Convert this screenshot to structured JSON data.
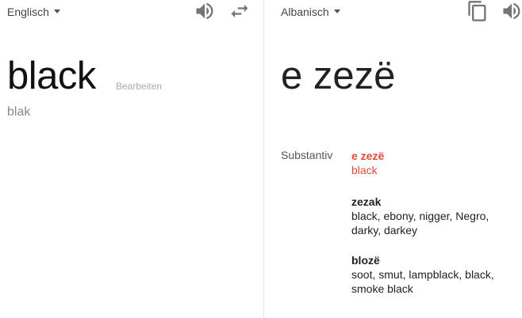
{
  "source": {
    "language": "Englisch",
    "text": "black",
    "edit_label": "Bearbeiten",
    "transliteration": "blak",
    "icons": [
      "speaker-icon",
      "swap-icon"
    ]
  },
  "target": {
    "language": "Albanisch",
    "text": "e zezë",
    "icons": [
      "copy-icon",
      "speaker-icon"
    ]
  },
  "dictionary": {
    "part_of_speech": "Substantiv",
    "entries": [
      {
        "term": "e zezë",
        "synonyms": "black",
        "highlight": true
      },
      {
        "term": "zezak",
        "synonyms": "black, ebony, nigger, Negro, darky, darkey",
        "highlight": false
      },
      {
        "term": "blozë",
        "synonyms": "soot, smut, lampblack, black, smoke black",
        "highlight": false
      }
    ]
  },
  "colors": {
    "highlight": "#dd4b39",
    "icon": "#757575",
    "divider": "#e5e5e5"
  }
}
